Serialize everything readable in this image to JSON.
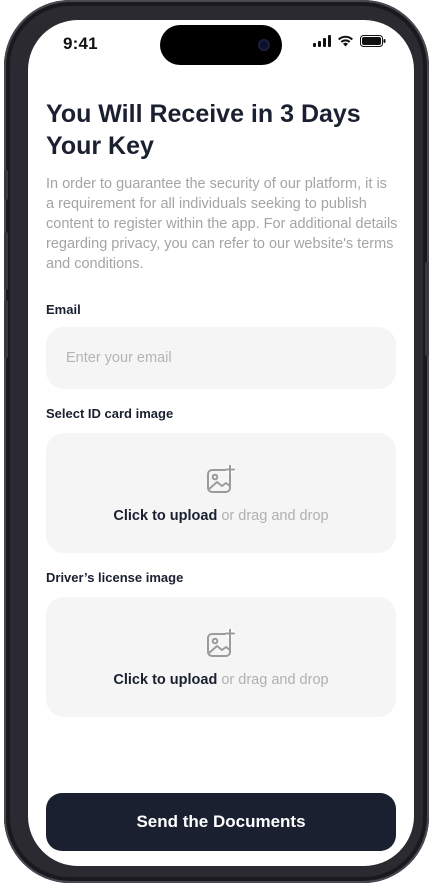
{
  "status_bar": {
    "time": "9:41"
  },
  "page": {
    "title": "You Will Receive in 3 Days Your Key",
    "description": "In order to guarantee the security of our platform, it is a requirement for all individuals seeking to publish content to register within the app. For additional details regarding privacy, you can refer to our website's terms and conditions."
  },
  "form": {
    "email": {
      "label": "Email",
      "placeholder": "Enter your email",
      "value": ""
    },
    "id_card": {
      "label": "Select ID card image",
      "upload_action": "Click to upload",
      "upload_hint": "or drag and drop"
    },
    "license": {
      "label": "Driver’s license image",
      "upload_action": "Click to upload",
      "upload_hint": "or drag and drop"
    },
    "submit_label": "Send the Documents"
  },
  "colors": {
    "primary": "#1a2030",
    "field_bg": "#f5f5f5",
    "muted_text": "#a4a4a4"
  },
  "icons": [
    "signal-icon",
    "wifi-icon",
    "battery-icon",
    "image-add-icon"
  ]
}
